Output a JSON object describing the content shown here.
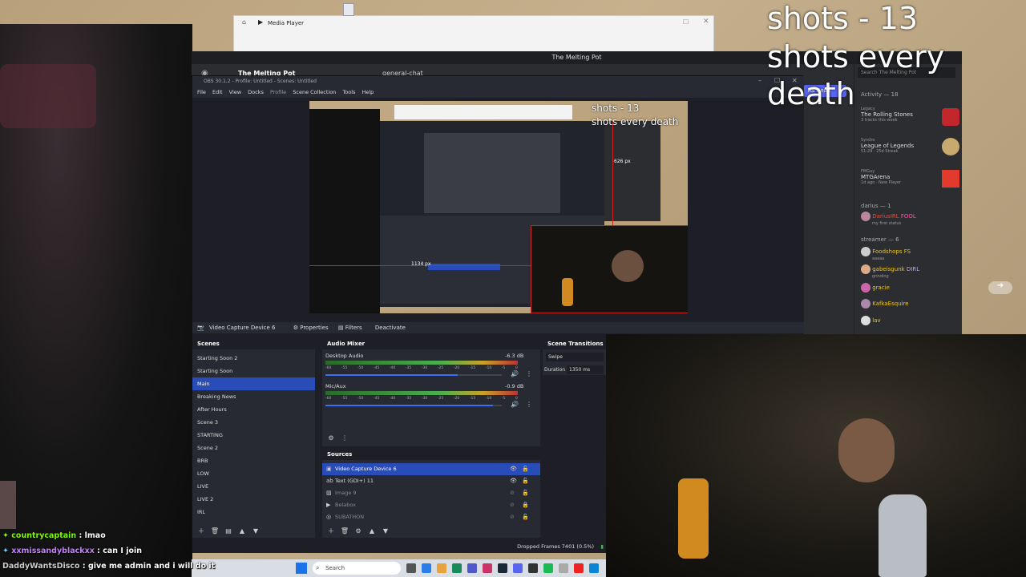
{
  "overlay": {
    "shots_count": "shots - 13",
    "shots_rule": "shots every death",
    "preview_shots_count": "shots - 13",
    "preview_shots_rule": "shots every death",
    "preview_px_h": "1134 px",
    "preview_px_v": "626 px"
  },
  "media_player": {
    "title": "Media Player"
  },
  "discord": {
    "window_title": "The Melting Pot",
    "server_name": "The Melting Pot",
    "channel": "general-chat",
    "mark_read": "As Read",
    "search_placeholder": "Search The Melting Pot",
    "activity_header": "Activity — 18",
    "activities": [
      {
        "user": "Legacy",
        "title": "The Rolling Stones",
        "sub": "3 tracks this week"
      },
      {
        "user": "Syndro",
        "title": "League of Legends",
        "sub": "51:29  ·  25d Streak"
      },
      {
        "user": "FMGuy",
        "title": "MTGArena",
        "sub": "1d ago  ·  New Player"
      }
    ],
    "group_darius": "darius — 1",
    "darius_member": {
      "name": "DariusIRL",
      "tag": "FOOL",
      "status": "my first status"
    },
    "group_streamer": "streamer — 6",
    "streamers": [
      {
        "name": "Foodshops",
        "tag": "FS",
        "status": "aaaaa"
      },
      {
        "name": "gabeisgunk",
        "tag": "DIRL",
        "status": "grinding"
      },
      {
        "name": "gracie",
        "tag": "",
        "status": ""
      },
      {
        "name": "KafkaEsquire",
        "tag": "",
        "status": ""
      },
      {
        "name": "lav",
        "tag": "",
        "status": ""
      }
    ]
  },
  "obs": {
    "title": "OBS 30.1.2 - Profile: Untitled - Scenes: Untitled",
    "menu": [
      "File",
      "Edit",
      "View",
      "Docks",
      "Profile",
      "Scene Collection",
      "Tools",
      "Help"
    ],
    "context_source": "Video Capture Device 6",
    "context_buttons": {
      "properties": "Properties",
      "filters": "Filters",
      "deactivate": "Deactivate"
    },
    "scenes_title": "Scenes",
    "scenes": [
      "Starting Soon 2",
      "Starting Soon",
      "Main",
      "Breaking News",
      "After Hours",
      "Scene 3",
      "STARTING",
      "Scene 2",
      "BRB",
      "LOW",
      "LIVE",
      "LIVE 2",
      "IRL"
    ],
    "active_scene": "Main",
    "mixer_title": "Audio Mixer",
    "mixer": [
      {
        "name": "Desktop Audio",
        "level": "-6.3 dB",
        "fader": 0.75
      },
      {
        "name": "Mic/Aux",
        "level": "-0.9 dB",
        "fader": 0.95
      }
    ],
    "meter_ticks": [
      "-60",
      "-55",
      "-50",
      "-45",
      "-40",
      "-35",
      "-30",
      "-25",
      "-20",
      "-15",
      "-10",
      "-5",
      "0"
    ],
    "sources_title": "Sources",
    "sources": [
      {
        "name": "Video Capture Device 6",
        "visible": true,
        "active": true
      },
      {
        "name": "Text (GDI+) 11",
        "visible": true,
        "active": false
      },
      {
        "name": "Image 9",
        "visible": false,
        "active": false
      },
      {
        "name": "Belabox",
        "visible": false,
        "active": false
      },
      {
        "name": "SUBATHON",
        "visible": false,
        "active": false
      }
    ],
    "transitions_title": "Scene Transitions",
    "transition": "Swipe",
    "duration_label": "Duration",
    "duration_value": "1350 ms",
    "dropped_frames": "Dropped Frames 7401 (0.5%)"
  },
  "chat": [
    {
      "user": "countrycaptain",
      "message": "lmao",
      "color": "#7CFC00"
    },
    {
      "user": "xxmissandyblackxx",
      "message": "can I join",
      "color": "#C77DFF"
    },
    {
      "user": "DaddyWantsDisco",
      "message": "give me admin and i will do it",
      "color": "#CCCCCC"
    }
  ],
  "taskbar": {
    "search": "Search"
  },
  "icons": [
    "play-icon",
    "home-icon",
    "discord-icon",
    "eye-icon",
    "lock-icon",
    "gear-icon",
    "plus-icon",
    "trash-icon",
    "up-icon",
    "down-icon",
    "speaker-icon",
    "windows-icon",
    "search-icon"
  ]
}
